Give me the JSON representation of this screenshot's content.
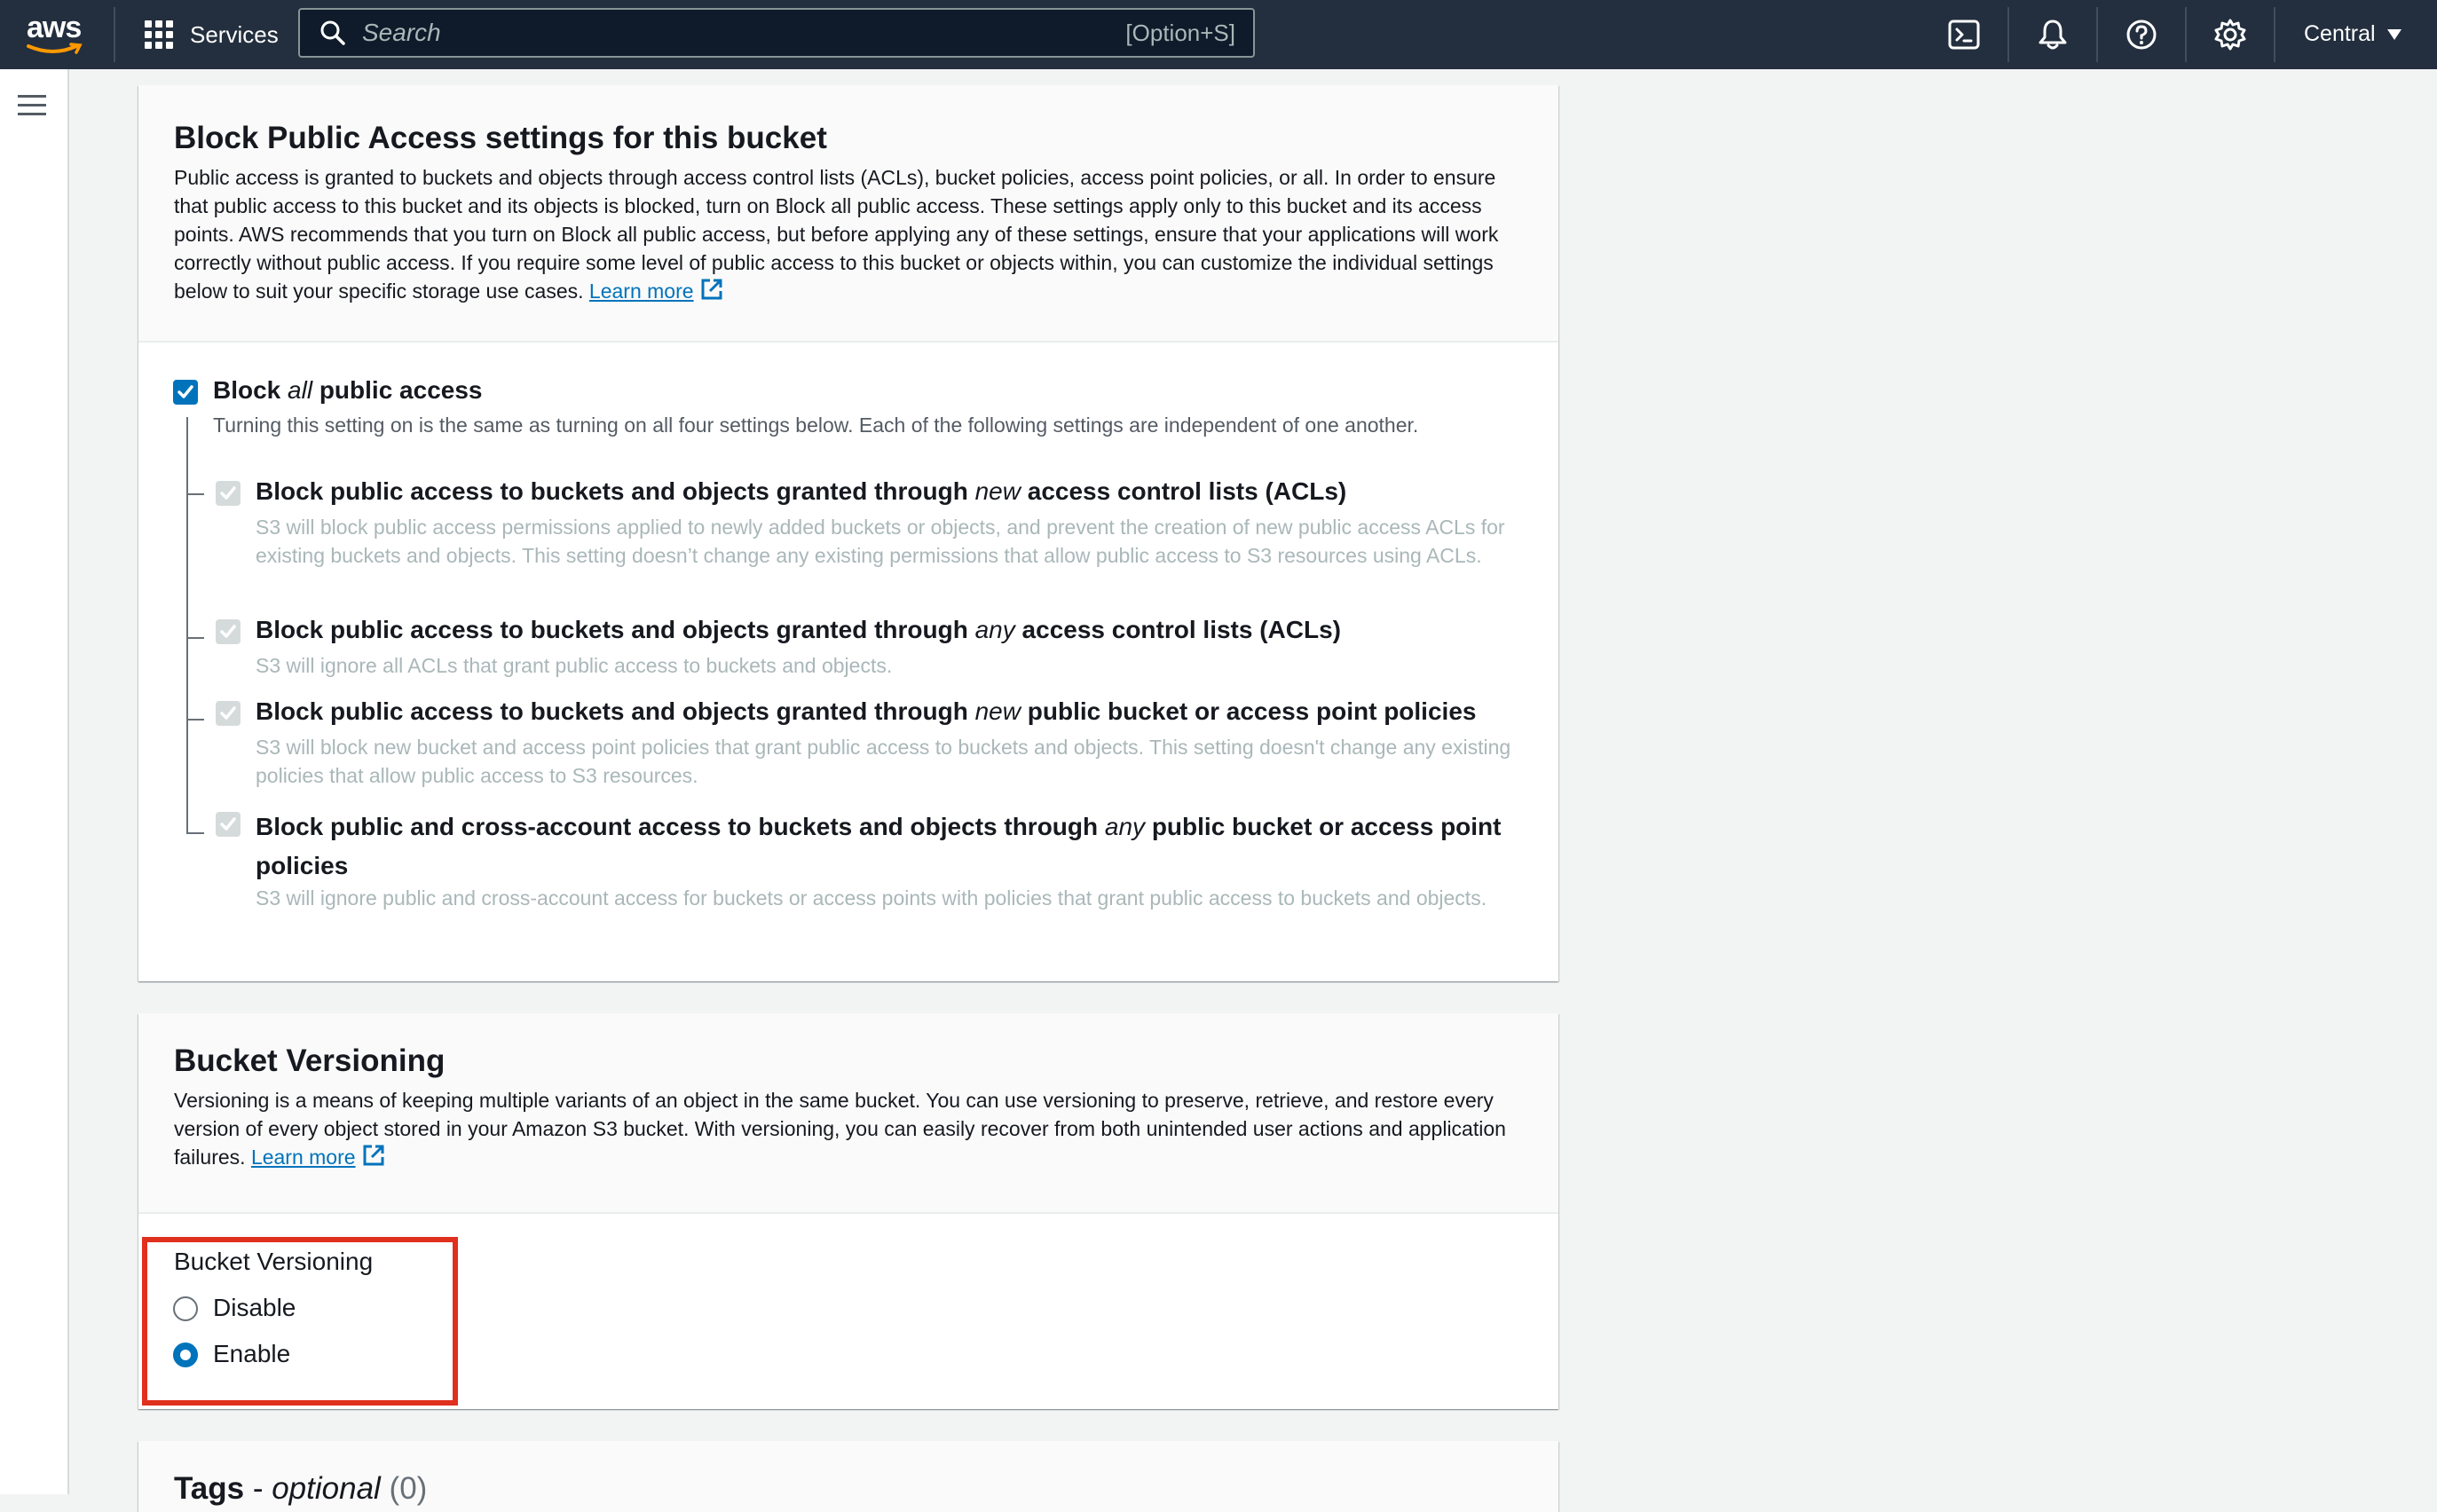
{
  "topbar": {
    "logo": "aws",
    "services_label": "Services",
    "search_placeholder": "Search",
    "search_shortcut": "[Option+S]",
    "icons": [
      "cloudshell-icon",
      "bell-icon",
      "help-icon",
      "gear-icon"
    ],
    "region": "Central"
  },
  "block_public_access": {
    "title": "Block Public Access settings for this bucket",
    "description": "Public access is granted to buckets and objects through access control lists (ACLs), bucket policies, access point policies, or all. In order to ensure that public access to this bucket and its objects is blocked, turn on Block all public access. These settings apply only to this bucket and its access points. AWS recommends that you turn on Block all public access, but before applying any of these settings, ensure that your applications will work correctly without public access. If you require some level of public access to this bucket or objects within, you can customize the individual settings below to suit your specific storage use cases.",
    "learn_more": "Learn more",
    "block_all": {
      "pre": "Block ",
      "em": "all",
      "post": " public access",
      "checked": true,
      "description": "Turning this setting on is the same as turning on all four settings below. Each of the following settings are independent of one another."
    },
    "options": [
      {
        "pre": "Block public access to buckets and objects granted through ",
        "em": "new",
        "post": " access control lists (ACLs)",
        "description": "S3 will block public access permissions applied to newly added buckets or objects, and prevent the creation of new public access ACLs for existing buckets and objects. This setting doesn’t change any existing permissions that allow public access to S3 resources using ACLs."
      },
      {
        "pre": "Block public access to buckets and objects granted through ",
        "em": "any",
        "post": " access control lists (ACLs)",
        "description": "S3 will ignore all ACLs that grant public access to buckets and objects."
      },
      {
        "pre": "Block public access to buckets and objects granted through ",
        "em": "new",
        "post": " public bucket or access point policies",
        "description": "S3 will block new bucket and access point policies that grant public access to buckets and objects. This setting doesn't change any existing policies that allow public access to S3 resources."
      },
      {
        "pre": "Block public and cross-account access to buckets and objects through ",
        "em": "any",
        "post": " public bucket or access point policies",
        "description": "S3 will ignore public and cross-account access for buckets or access points with policies that grant public access to buckets and objects."
      }
    ]
  },
  "versioning": {
    "title": "Bucket Versioning",
    "description": "Versioning is a means of keeping multiple variants of an object in the same bucket. You can use versioning to preserve, retrieve, and restore every version of every object stored in your Amazon S3 bucket. With versioning, you can easily recover from both unintended user actions and application failures.",
    "learn_more": "Learn more",
    "field_label": "Bucket Versioning",
    "options": [
      "Disable",
      "Enable"
    ],
    "selected": "Enable"
  },
  "tags": {
    "title": "Tags",
    "dash": " - ",
    "optional": "optional",
    "count": "(0)"
  },
  "colors": {
    "topbar": "#232f3e",
    "accent": "#0073bb",
    "highlight": "#e0301e"
  }
}
